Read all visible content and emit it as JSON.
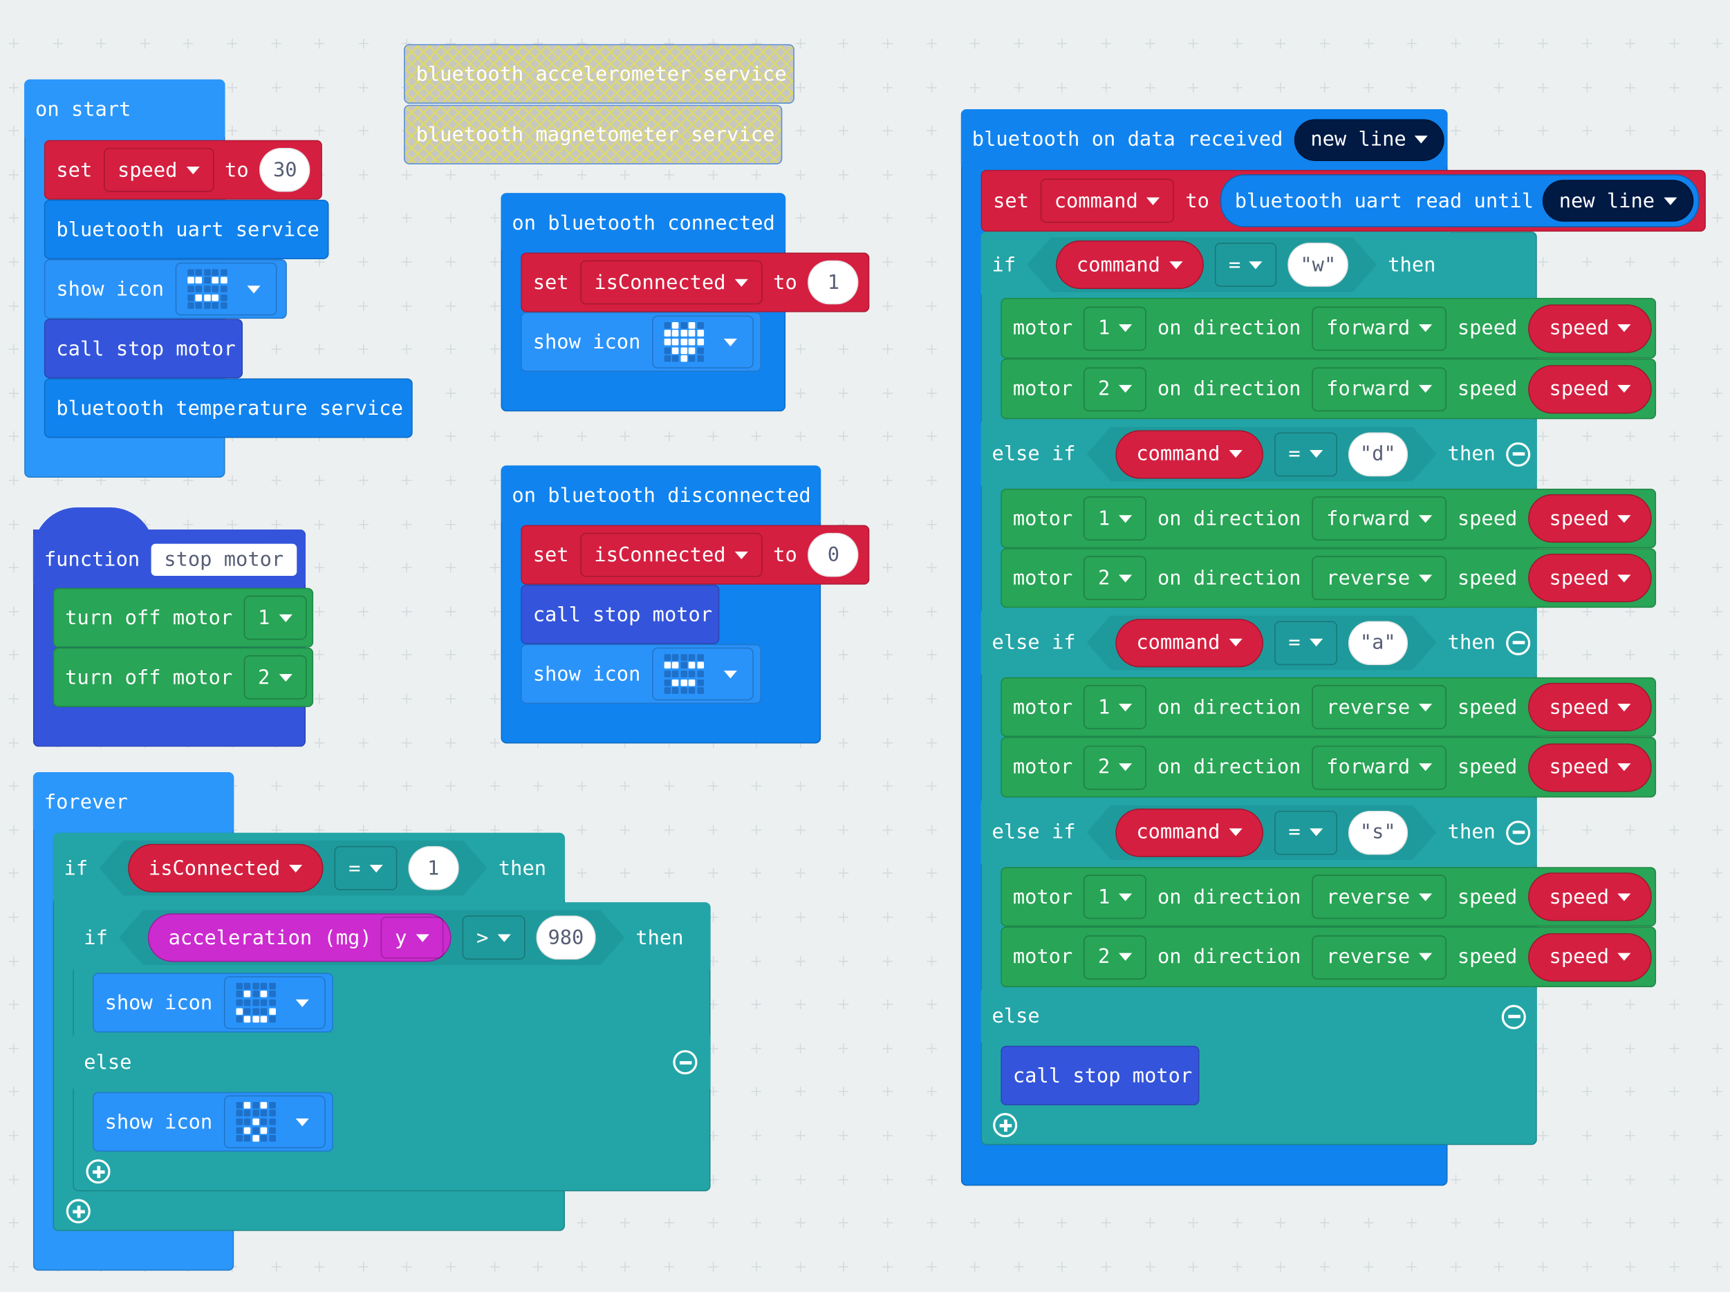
{
  "colors": {
    "event": "#2b97fb",
    "bluetooth": "#1083ef",
    "variables": "#d51f40",
    "basic": "#2a93fa",
    "functions": "#3455db",
    "motors": "#28a556",
    "logic": "#23a5a7",
    "input": "#cc2bcf",
    "disabled": "#c7c7c2"
  },
  "on_start": {
    "label": "on start",
    "set": {
      "kw": "set",
      "var": "speed",
      "to": "to",
      "value": "30"
    },
    "uart": "bluetooth uart service",
    "show_icon": "show icon",
    "icon": [
      "00000",
      "11011",
      "00000",
      "01110",
      "00000"
    ],
    "call": "call stop motor",
    "temperature": "bluetooth temperature service"
  },
  "disabled": {
    "accelerometer": "bluetooth accelerometer service",
    "magnetometer": "bluetooth magnetometer service"
  },
  "connected": {
    "label": "on bluetooth connected",
    "set": {
      "kw": "set",
      "var": "isConnected",
      "to": "to",
      "value": "1"
    },
    "show_icon": "show icon",
    "icon": [
      "01010",
      "11111",
      "11111",
      "01110",
      "00100"
    ]
  },
  "disconnected": {
    "label": "on bluetooth disconnected",
    "set": {
      "kw": "set",
      "var": "isConnected",
      "to": "to",
      "value": "0"
    },
    "call": "call stop motor",
    "show_icon": "show icon",
    "icon": [
      "00000",
      "11011",
      "00000",
      "01110",
      "00000"
    ]
  },
  "function": {
    "kw": "function",
    "name": "stop motor",
    "steps": [
      {
        "label": "turn off motor",
        "motor": "1"
      },
      {
        "label": "turn off motor",
        "motor": "2"
      }
    ]
  },
  "forever": {
    "label": "forever",
    "outer_if": {
      "kw": "if",
      "var": "isConnected",
      "op": "=",
      "value": "1",
      "then": "then"
    },
    "inner_if": {
      "kw": "if",
      "sensor": "acceleration (mg)",
      "axis": "y",
      "op": ">",
      "value": "980",
      "then": "then"
    },
    "show_icon": "show icon",
    "icon_then": [
      "00000",
      "01010",
      "00000",
      "10001",
      "01110"
    ],
    "else": "else",
    "icon_else": [
      "01010",
      "00000",
      "00100",
      "01010",
      "00100"
    ]
  },
  "data_received": {
    "header": "bluetooth on data received",
    "delimiter": "new line",
    "set": {
      "kw": "set",
      "var": "command",
      "to": "to",
      "read": "bluetooth uart read until",
      "delimiter": "new line"
    },
    "branches": [
      {
        "kw": "if",
        "var": "command",
        "op": "=",
        "value": "\"w\"",
        "then": "then",
        "motors": [
          {
            "label": "motor",
            "id": "1",
            "on_direction": "on direction",
            "direction": "forward",
            "speed_label": "speed",
            "speed_var": "speed"
          },
          {
            "label": "motor",
            "id": "2",
            "on_direction": "on direction",
            "direction": "forward",
            "speed_label": "speed",
            "speed_var": "speed"
          }
        ]
      },
      {
        "kw": "else if",
        "var": "command",
        "op": "=",
        "value": "\"d\"",
        "then": "then",
        "motors": [
          {
            "label": "motor",
            "id": "1",
            "on_direction": "on direction",
            "direction": "forward",
            "speed_label": "speed",
            "speed_var": "speed"
          },
          {
            "label": "motor",
            "id": "2",
            "on_direction": "on direction",
            "direction": "reverse",
            "speed_label": "speed",
            "speed_var": "speed"
          }
        ]
      },
      {
        "kw": "else if",
        "var": "command",
        "op": "=",
        "value": "\"a\"",
        "then": "then",
        "motors": [
          {
            "label": "motor",
            "id": "1",
            "on_direction": "on direction",
            "direction": "reverse",
            "speed_label": "speed",
            "speed_var": "speed"
          },
          {
            "label": "motor",
            "id": "2",
            "on_direction": "on direction",
            "direction": "forward",
            "speed_label": "speed",
            "speed_var": "speed"
          }
        ]
      },
      {
        "kw": "else if",
        "var": "command",
        "op": "=",
        "value": "\"s\"",
        "then": "then",
        "motors": [
          {
            "label": "motor",
            "id": "1",
            "on_direction": "on direction",
            "direction": "reverse",
            "speed_label": "speed",
            "speed_var": "speed"
          },
          {
            "label": "motor",
            "id": "2",
            "on_direction": "on direction",
            "direction": "reverse",
            "speed_label": "speed",
            "speed_var": "speed"
          }
        ]
      }
    ],
    "else": "else",
    "call": "call stop motor"
  }
}
